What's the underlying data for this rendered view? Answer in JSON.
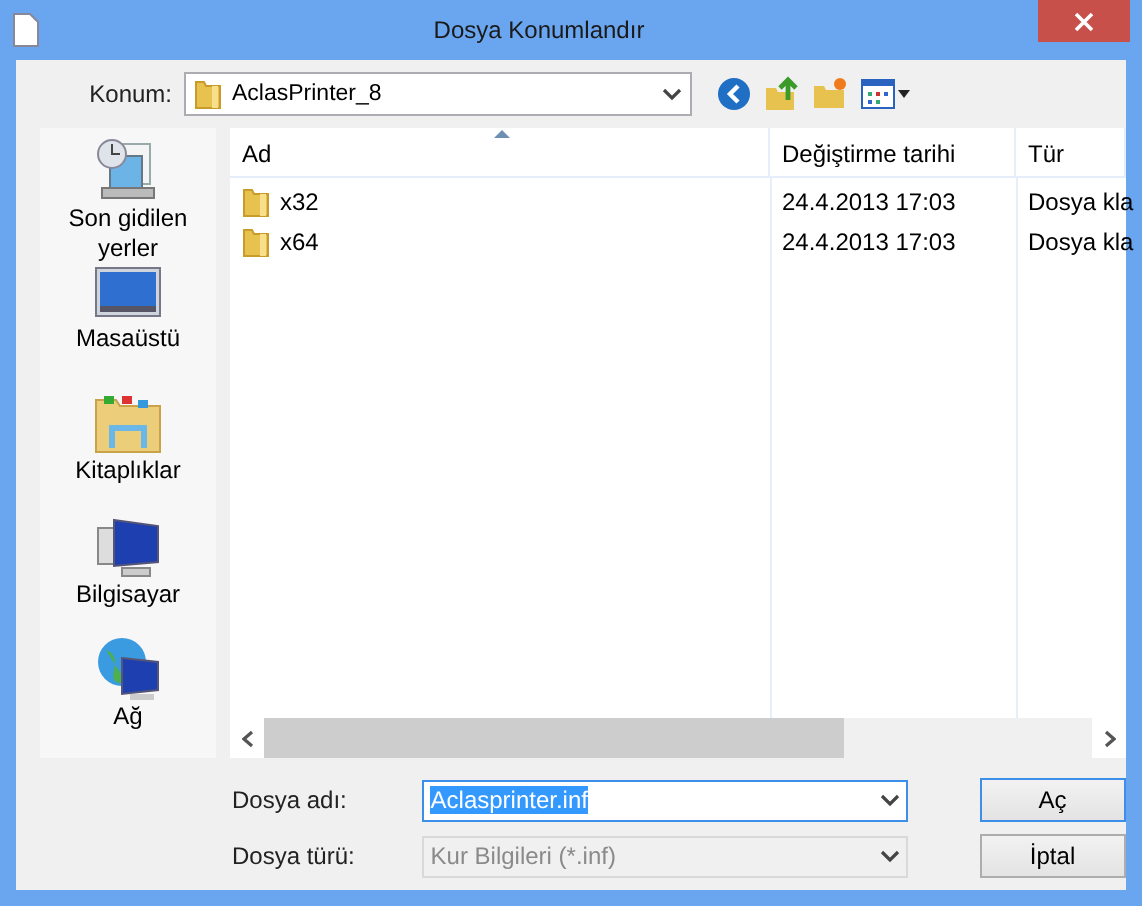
{
  "window": {
    "title": "Dosya Konumlandır"
  },
  "location": {
    "label": "Konum:",
    "value": "AclasPrinter_8"
  },
  "sidebar": {
    "items": [
      {
        "label": "Son gidilen yerler",
        "kind": "recent"
      },
      {
        "label": "Masaüstü",
        "kind": "desktop"
      },
      {
        "label": "Kitaplıklar",
        "kind": "libraries"
      },
      {
        "label": "Bilgisayar",
        "kind": "computer"
      },
      {
        "label": "Ağ",
        "kind": "network"
      }
    ]
  },
  "table": {
    "columns": [
      "Ad",
      "Değiştirme tarihi",
      "Tür"
    ],
    "rows": [
      {
        "name": "x32",
        "modified": "24.4.2013 17:03",
        "type": "Dosya kla"
      },
      {
        "name": "x64",
        "modified": "24.4.2013 17:03",
        "type": "Dosya kla"
      }
    ]
  },
  "file_name": {
    "label": "Dosya adı:",
    "value": "Aclasprinter.inf",
    "text_selected": true
  },
  "file_type": {
    "label": "Dosya türü:",
    "value": "Kur Bilgileri (*.inf)",
    "disabled": true
  },
  "buttons": [
    "Aç",
    "İptal"
  ]
}
